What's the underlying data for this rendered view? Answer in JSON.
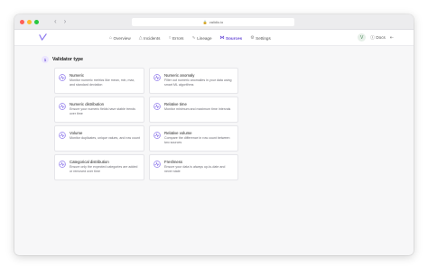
{
  "browser": {
    "url": "validio.io"
  },
  "nav": {
    "items": [
      {
        "label": "Overview",
        "icon": "home-icon"
      },
      {
        "label": "Incidents",
        "icon": "bell-icon"
      },
      {
        "label": "Errors",
        "icon": "error-icon"
      },
      {
        "label": "Lineage",
        "icon": "lineage-icon"
      },
      {
        "label": "Sources",
        "icon": "sources-icon",
        "active": true
      },
      {
        "label": "Settings",
        "icon": "gear-icon"
      }
    ],
    "avatar_initial": "V",
    "docs_label": "Docs"
  },
  "section": {
    "step": "1",
    "title": "Validator type"
  },
  "validators": [
    {
      "title": "Numeric",
      "desc": "Monitor numeric metrics like mean, min, max, and standard deviation"
    },
    {
      "title": "Numeric anomaly",
      "desc": "Filter out numeric anomalies in your data using smart ML algorithms"
    },
    {
      "title": "Numeric distribution",
      "desc": "Ensure your numeric fields have stable trends over time"
    },
    {
      "title": "Relative time",
      "desc": "Monitor minimum and maximum time intervals"
    },
    {
      "title": "Volume",
      "desc": "Monitor duplicates, unique values, and row count"
    },
    {
      "title": "Relative volume",
      "desc": "Compare the difference in row count between two sources"
    },
    {
      "title": "Categorical distribution",
      "desc": "Ensure only the expected categories are added or removed over time"
    },
    {
      "title": "Freshness",
      "desc": "Ensure your data is always up-to-date and never stale"
    }
  ],
  "colors": {
    "accent": "#6a4cd6",
    "icon_tint": "#7b61e8"
  }
}
